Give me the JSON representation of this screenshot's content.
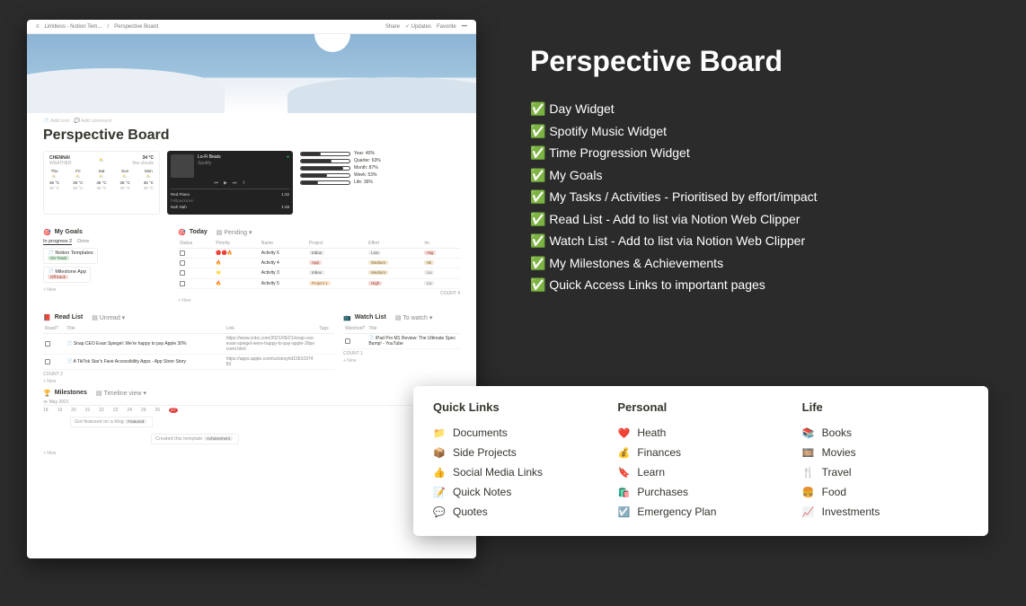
{
  "titlebar": {
    "menu_icon": "≡",
    "breadcrumb1": "Limitless - Notion Tem...",
    "breadcrumb2": "Perspective Board",
    "share": "Share",
    "updates": "Updates",
    "favorite": "Favorite",
    "more": "•••"
  },
  "page": {
    "add_icon": "Add icon",
    "add_comment": "Add comment",
    "title": "Perspective Board"
  },
  "weather": {
    "city_label": "CHENNAI",
    "subtitle": "WEATHER",
    "temp": "34 °C",
    "cond": "few clouds",
    "days": [
      "Thu",
      "Fri",
      "Sat",
      "Sun",
      "Mon"
    ],
    "hi": [
      "36 °C",
      "36 °C",
      "36 °C",
      "36 °C",
      "36 °C"
    ],
    "lo": [
      "30 °C",
      "30 °C",
      "30 °C",
      "30 °C",
      "30 °C"
    ]
  },
  "spotify": {
    "now_title": "Lo-Fi Beats",
    "now_sub": "Spotify",
    "tracks": [
      {
        "t": "Red Piano",
        "a": "Fellpackmen",
        "d": "1:32"
      },
      {
        "t": "Nah Nah",
        "a": "",
        "d": "1:48"
      }
    ]
  },
  "progress": [
    {
      "label": "Year: 40%",
      "pct": 40
    },
    {
      "label": "Quarter: 63%",
      "pct": 63
    },
    {
      "label": "Month: 87%",
      "pct": 87
    },
    {
      "label": "Week: 53%",
      "pct": 53
    },
    {
      "label": "Life: 36%",
      "pct": 36
    }
  ],
  "goals": {
    "header": "My Goals",
    "tab_inprogress": "In progress",
    "tab_inprogress_n": "2",
    "tab_done": "Done",
    "items": [
      {
        "name": "Notion Templates",
        "status": "On Track"
      },
      {
        "name": "Milestone App",
        "status": "Off track"
      }
    ],
    "new": "+  New"
  },
  "today": {
    "header": "Today",
    "view": "Pending",
    "cols": [
      "Status",
      "Priority",
      "Name",
      "Project",
      "Effort",
      "Im"
    ],
    "rows": [
      {
        "p": "🔴🔴🔥",
        "name": "Activity 6",
        "proj": "Inbox",
        "eff": "Low",
        "imp": "Hig"
      },
      {
        "p": "🔥",
        "name": "Activity 4",
        "proj": "App",
        "eff": "Medium",
        "imp": "Mi"
      },
      {
        "p": "⭐",
        "name": "Activity 3",
        "proj": "Inbox",
        "eff": "Medium",
        "imp": "Lo"
      },
      {
        "p": "🔥",
        "name": "Activity 5",
        "proj": "Project 1",
        "eff": "High",
        "imp": "Lo"
      }
    ],
    "count": "COUNT 4",
    "new": "+  New"
  },
  "readlist": {
    "header": "Read List",
    "view": "Unread",
    "cols": [
      "Read?",
      "Title",
      "Link",
      "Tags"
    ],
    "rows": [
      {
        "title": "Snap CEO Evan Spiegel: We're happy to pay Apple 30%",
        "link": "https://www.cnbc.com/2021/05/21/snap-ceo-evan-spiegel-were-happy-to-pay-apple-30percent.html"
      },
      {
        "title": "A TikTok Star's Fave Accessibility Apps - App Store Story",
        "link": "https://apps.apple.com/us/story/id1561037483"
      }
    ],
    "count": "COUNT 2",
    "new": "+  New"
  },
  "watchlist": {
    "header": "Watch List",
    "view": "To watch",
    "cols": [
      "Watched?",
      "Title"
    ],
    "rows": [
      {
        "title": "iPad Pro M1 Review: The Ultimate Spec Bump! - YouTube"
      }
    ],
    "count": "COUNT 1",
    "new": "+  New"
  },
  "milestones": {
    "header": "Milestones",
    "view": "Timeline view",
    "month": "May 2021",
    "days": [
      "18",
      "19",
      "20",
      "21",
      "22",
      "23",
      "24",
      "25",
      "26",
      "27"
    ],
    "bars": [
      {
        "t": "Got featured on a blog",
        "tag": "Featured"
      },
      {
        "t": "Created this template",
        "tag": "Achievement"
      }
    ],
    "new": "+  New"
  },
  "promo": {
    "title": "Perspective Board",
    "features": [
      "Day Widget",
      "Spotify Music Widget",
      "Time Progression Widget",
      "My Goals",
      "My Tasks / Activities - Prioritised by effort/impact",
      "Read List - Add to list via Notion Web Clipper",
      "Watch List - Add to list via Notion Web Clipper",
      "My Milestones & Achievements",
      "Quick Access Links to important pages"
    ]
  },
  "quicklinks": {
    "col1": {
      "h": "Quick Links",
      "items": [
        {
          "i": "📁",
          "t": "Documents"
        },
        {
          "i": "📦",
          "t": "Side Projects"
        },
        {
          "i": "👍",
          "t": "Social Media Links"
        },
        {
          "i": "📝",
          "t": "Quick Notes"
        },
        {
          "i": "💬",
          "t": "Quotes"
        }
      ]
    },
    "col2": {
      "h": "Personal",
      "items": [
        {
          "i": "❤️",
          "t": "Heath"
        },
        {
          "i": "💰",
          "t": "Finances"
        },
        {
          "i": "🔖",
          "t": "Learn"
        },
        {
          "i": "🛍️",
          "t": "Purchases"
        },
        {
          "i": "☑️",
          "t": "Emergency Plan"
        }
      ]
    },
    "col3": {
      "h": "Life",
      "items": [
        {
          "i": "📚",
          "t": "Books"
        },
        {
          "i": "🎞️",
          "t": "Movies"
        },
        {
          "i": "🍴",
          "t": "Travel"
        },
        {
          "i": "🍔",
          "t": "Food"
        },
        {
          "i": "📈",
          "t": "Investments"
        }
      ]
    }
  }
}
